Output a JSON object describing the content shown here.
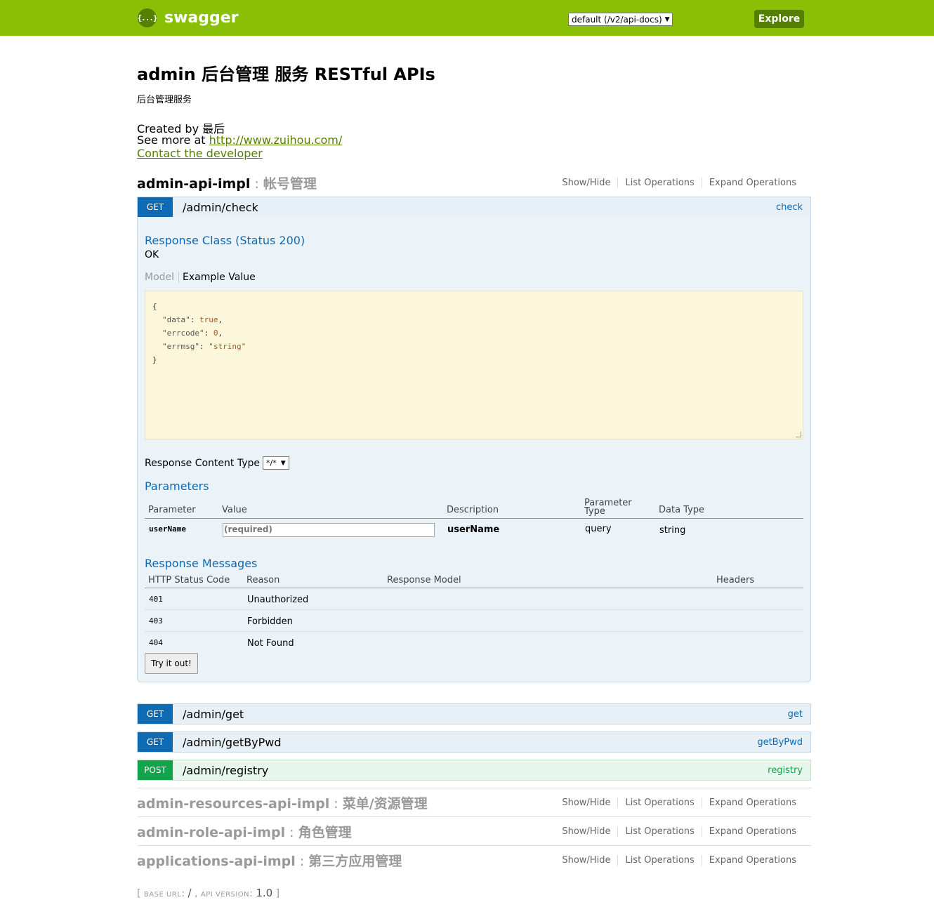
{
  "header": {
    "logo_text": "swagger",
    "logo_symbol": "{...}",
    "spec_select": "default (/v2/api-docs)",
    "explore_label": "Explore"
  },
  "info": {
    "title": "admin 后台管理 服务 RESTful APIs",
    "description": "后台管理服务",
    "created_by": "Created by 最后",
    "see_more_prefix": "See more at",
    "see_more_link": "http://www.zuihou.com/",
    "contact": "Contact the developer"
  },
  "resource_ops": {
    "show_hide": "Show/Hide",
    "list_ops": "List Operations",
    "expand_ops": "Expand Operations"
  },
  "resources": [
    {
      "name": "admin-api-impl",
      "sep": " : ",
      "desc": "帐号管理"
    },
    {
      "name": "admin-resources-api-impl",
      "sep": " : ",
      "desc": "菜单/资源管理"
    },
    {
      "name": "admin-role-api-impl",
      "sep": " : ",
      "desc": "角色管理"
    },
    {
      "name": "applications-api-impl",
      "sep": " : ",
      "desc": "第三方应用管理"
    }
  ],
  "operations": [
    {
      "method": "GET",
      "path": "/admin/check",
      "nickname": "check"
    },
    {
      "method": "GET",
      "path": "/admin/get",
      "nickname": "get"
    },
    {
      "method": "GET",
      "path": "/admin/getByPwd",
      "nickname": "getByPwd"
    },
    {
      "method": "POST",
      "path": "/admin/registry",
      "nickname": "registry"
    }
  ],
  "check_detail": {
    "response_class": "Response Class (Status 200)",
    "response_class_value": "OK",
    "tab_model": "Model",
    "tab_example": "Example Value",
    "example_json": {
      "open": "{",
      "k1": "\"data\"",
      "v1": "true",
      "k2": "\"errcode\"",
      "v2": "0",
      "k3": "\"errmsg\"",
      "v3": "\"string\"",
      "close": "}"
    },
    "response_content_type_label": "Response Content Type",
    "response_content_type": "*/*",
    "parameters_title": "Parameters",
    "param_headers": {
      "parameter": "Parameter",
      "value": "Value",
      "description": "Description",
      "param_type_1": "Parameter",
      "param_type_2": "Type",
      "data_type": "Data Type"
    },
    "param_row": {
      "name": "userName",
      "placeholder": "(required)",
      "description": "userName",
      "param_type": "query",
      "data_type": "string"
    },
    "response_messages_title": "Response Messages",
    "resp_headers": {
      "status": "HTTP Status Code",
      "reason": "Reason",
      "model": "Response Model",
      "headers": "Headers"
    },
    "resp_rows": [
      {
        "code": "401",
        "reason": "Unauthorized"
      },
      {
        "code": "403",
        "reason": "Forbidden"
      },
      {
        "code": "404",
        "reason": "Not Found"
      }
    ],
    "try_label": "Try it out!"
  },
  "footer": {
    "base_url_label": "base url",
    "base_url": "/",
    "api_version_label": "api version",
    "api_version": "1.0"
  }
}
